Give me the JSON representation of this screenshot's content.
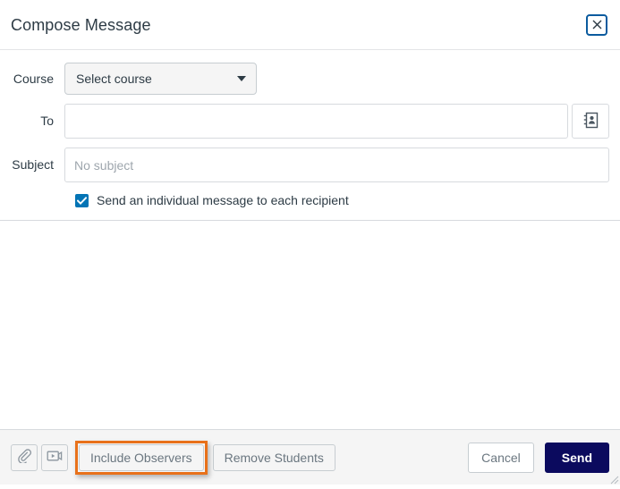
{
  "window": {
    "title": "Compose Message",
    "close_icon": "close-x-icon"
  },
  "form": {
    "course": {
      "label": "Course",
      "selected": "Select course",
      "options": [
        "Select course"
      ]
    },
    "to": {
      "label": "To",
      "value": "",
      "placeholder": "",
      "address_book_icon": "address-book-icon"
    },
    "subject": {
      "label": "Subject",
      "value": "",
      "placeholder": "No subject"
    },
    "individual_message": {
      "label": "Send an individual message to each recipient",
      "checked": true
    }
  },
  "body": {
    "value": "",
    "placeholder": ""
  },
  "footer": {
    "attachment_icon": "paperclip-icon",
    "media_icon": "media-recording-icon",
    "include_observers_label": "Include Observers",
    "remove_students_label": "Remove Students",
    "cancel_label": "Cancel",
    "send_label": "Send"
  },
  "colors": {
    "highlight": "#e8711a",
    "send_button": "#0b0a5e",
    "checkbox": "#0374b5",
    "focus_ring": "#0b5b9e",
    "text": "#2d3b45",
    "muted_text": "#6b7780",
    "border": "#c7cdd1",
    "footer_bg": "#f5f5f5"
  }
}
